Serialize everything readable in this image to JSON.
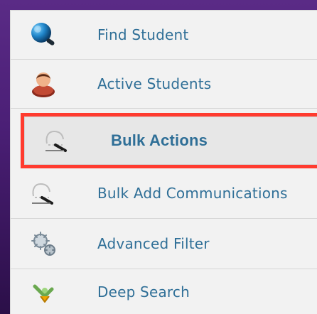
{
  "menu": {
    "items": [
      {
        "label": "Find Student",
        "icon": "find-student-icon"
      },
      {
        "label": "Active Students",
        "icon": "active-students-icon"
      },
      {
        "label": "Bulk Actions",
        "icon": "bulk-actions-icon",
        "selected": true
      },
      {
        "label": "Bulk Add Communications",
        "icon": "bulk-add-communications-icon"
      },
      {
        "label": "Advanced Filter",
        "icon": "advanced-filter-icon"
      },
      {
        "label": "Deep Search",
        "icon": "deep-search-icon"
      }
    ]
  },
  "colors": {
    "frame_purple": "#4b1f76",
    "panel_bg": "#f2f2f2",
    "label_blue": "#2f6f97",
    "selected_outline": "#ff3b2f",
    "selected_bg": "#e7e7e7",
    "divider": "#d6d6d6"
  }
}
